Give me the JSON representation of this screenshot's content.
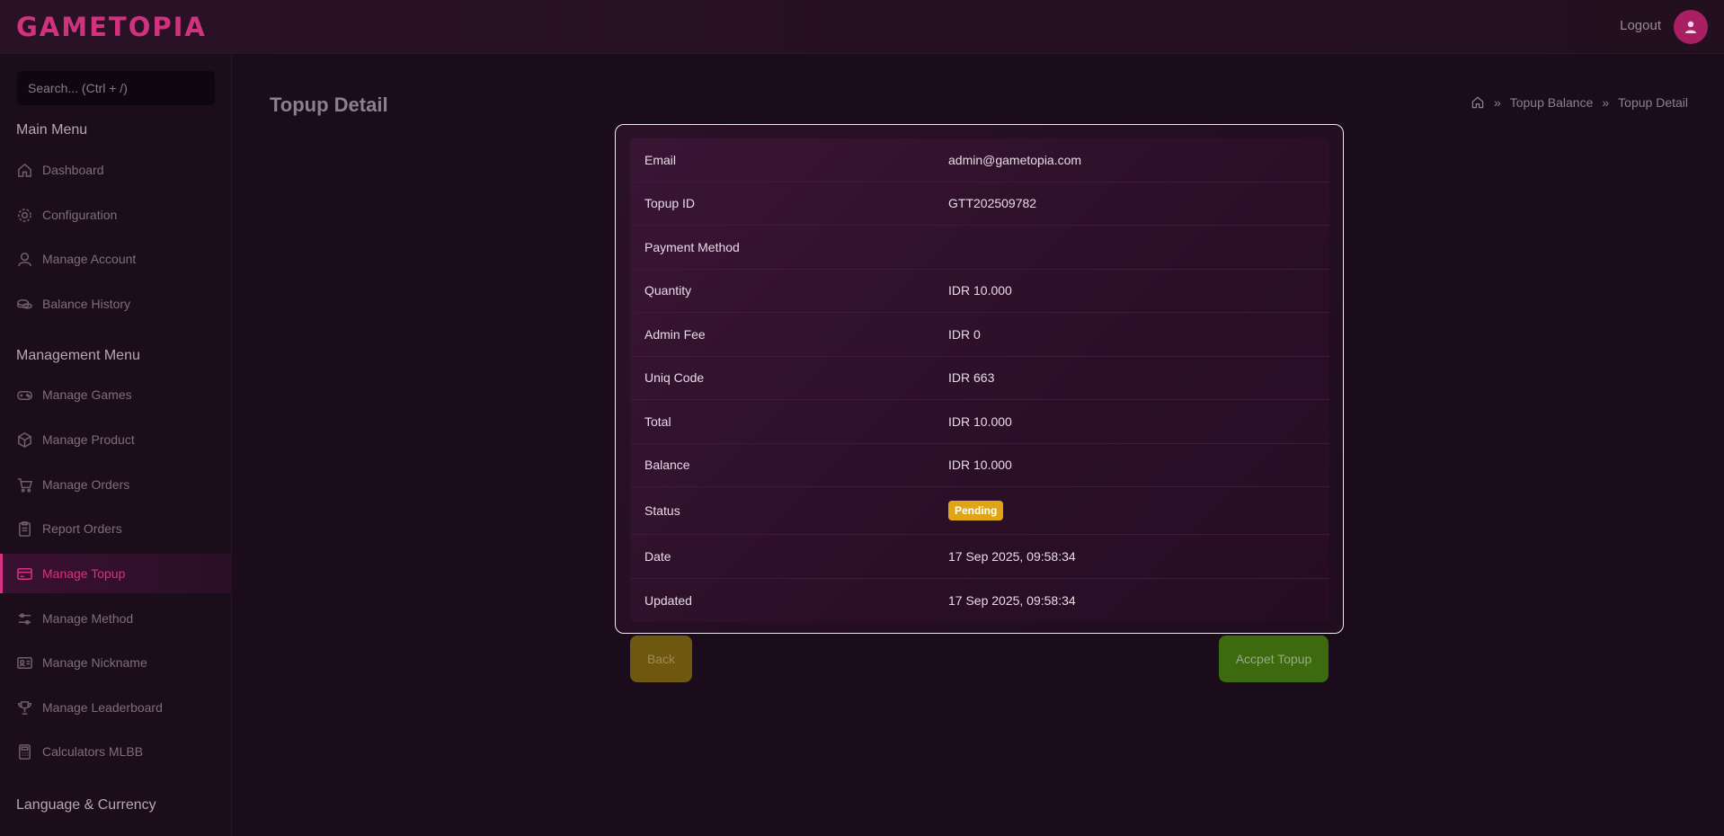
{
  "app": {
    "logo": "GAMETOPIA",
    "logout": "Logout"
  },
  "search": {
    "placeholder": "Search... (Ctrl + /)"
  },
  "sidebar": {
    "main_menu": "Main Menu",
    "management_menu": "Management Menu",
    "language_currency": "Language & Currency",
    "items": [
      {
        "label": "Dashboard",
        "icon": "home-icon"
      },
      {
        "label": "Configuration",
        "icon": "gear-icon"
      },
      {
        "label": "Manage Account",
        "icon": "user-icon"
      },
      {
        "label": "Balance History",
        "icon": "coins-icon"
      },
      {
        "label": "Manage Games",
        "icon": "gamepad-icon"
      },
      {
        "label": "Manage Product",
        "icon": "box-icon"
      },
      {
        "label": "Manage Orders",
        "icon": "cart-icon"
      },
      {
        "label": "Report Orders",
        "icon": "clipboard-icon"
      },
      {
        "label": "Manage Topup",
        "icon": "card-icon",
        "active": true
      },
      {
        "label": "Manage Method",
        "icon": "sliders-icon"
      },
      {
        "label": "Manage Nickname",
        "icon": "id-card-icon"
      },
      {
        "label": "Manage Leaderboard",
        "icon": "trophy-icon"
      },
      {
        "label": "Calculators MLBB",
        "icon": "calculator-icon"
      }
    ]
  },
  "page": {
    "title": "Topup Detail",
    "breadcrumb": [
      "Topup Balance",
      "Topup Detail"
    ]
  },
  "detail": {
    "rows": [
      {
        "key": "Email",
        "value": "admin@gametopia.com"
      },
      {
        "key": "Topup ID",
        "value": "GTT202509782"
      },
      {
        "key": "Payment Method",
        "value": ""
      },
      {
        "key": "Quantity",
        "value": "IDR 10.000"
      },
      {
        "key": "Admin Fee",
        "value": "IDR 0"
      },
      {
        "key": "Uniq Code",
        "value": "IDR 663"
      },
      {
        "key": "Total",
        "value": "IDR 10.000"
      },
      {
        "key": "Balance",
        "value": "IDR 10.000"
      },
      {
        "key": "Status",
        "value": "Pending"
      },
      {
        "key": "Date",
        "value": "17 Sep 2025, 09:58:34"
      },
      {
        "key": "Updated",
        "value": "17 Sep 2025, 09:58:34"
      }
    ]
  },
  "actions": {
    "back": "Back",
    "accept": "Accpet Topup"
  },
  "colors": {
    "accent": "#d63384",
    "status_pending": "#e0a515",
    "accept_button": "#3d6a0f",
    "back_button": "#6e5810"
  }
}
